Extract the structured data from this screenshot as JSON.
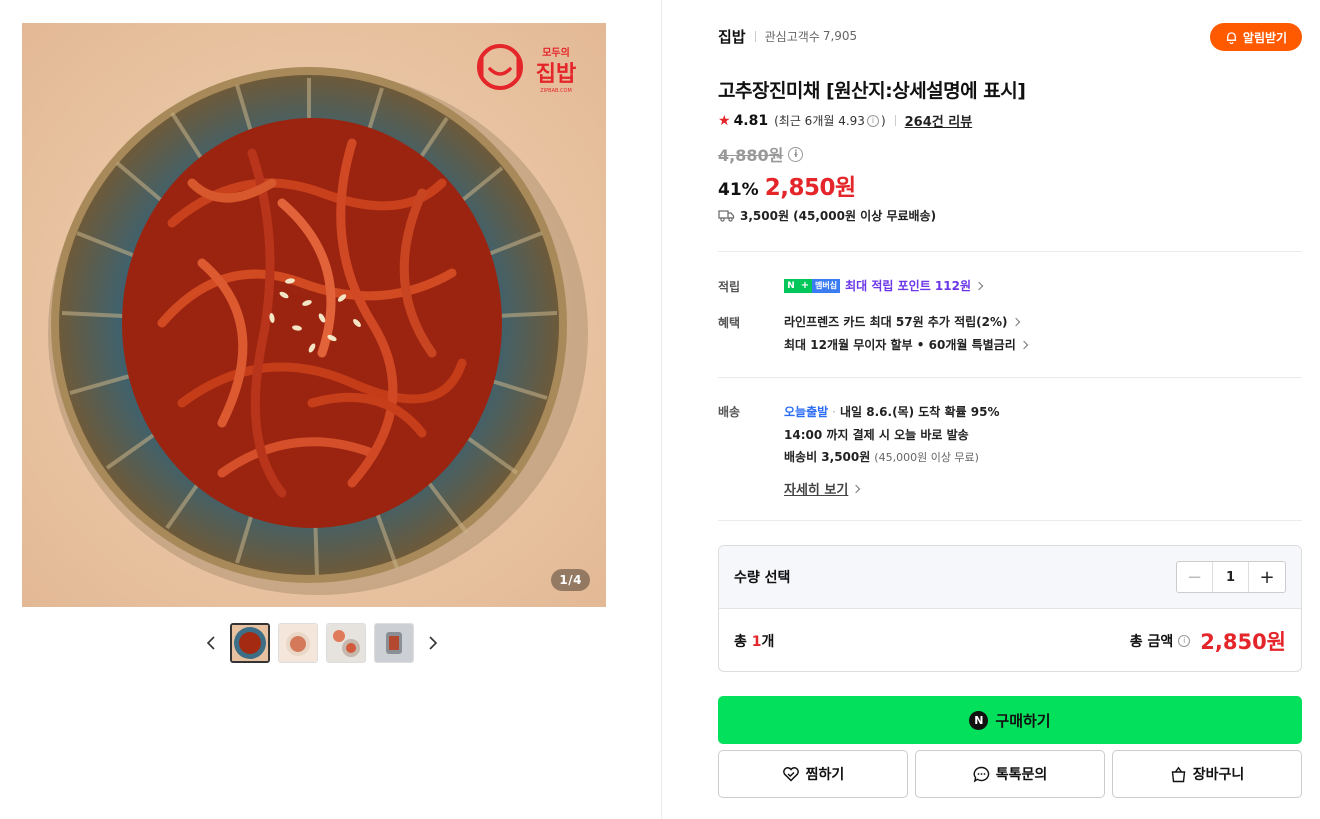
{
  "gallery": {
    "counter": "1/4",
    "brand_top": "모두의",
    "brand_main": "집밥",
    "brand_sub": "ZIPBAB.COM",
    "thumb_count": 4
  },
  "store": {
    "name": "집밥",
    "fan_label": "관심고객수",
    "fan_count": "7,905",
    "alarm_label": "알림받기"
  },
  "product": {
    "title": "고추장진미채 [원산지:상세설명에 표시]",
    "rating": "4.81",
    "recent_rating": "(최근 6개월 4.93",
    "recent_close": ")",
    "review_count": "264건 리뷰",
    "original_price": "4,880원",
    "discount": "41%",
    "price": "2,850원",
    "shipping": "3,500원 (45,000원 이상 무료배송)"
  },
  "benefits": {
    "points_label": "적립",
    "points_badge_n": "N",
    "points_badge_plus": "+",
    "points_badge_member": "멤버십",
    "points_text": "최대 적립 포인트 112원",
    "perks_label": "혜택",
    "perk1": "라인프렌즈 카드 최대 57원 추가 적립(2%)",
    "perk2": "최대 12개월 무이자 할부 • 60개월 특별금리"
  },
  "delivery": {
    "label": "배송",
    "today": "오늘출발",
    "arrival": "내일 8.6.(목) 도착 확률 95%",
    "cutoff": "14:00 까지 결제 시 오늘 바로 발송",
    "fee": "배송비 3,500원",
    "fee_note": "(45,000원 이상 무료)",
    "detail_link": "자세히 보기"
  },
  "quantity": {
    "label": "수량 선택",
    "value": "1",
    "total_prefix": "총 ",
    "total_count": "1",
    "total_suffix": "개",
    "total_label": "총 금액",
    "total_price": "2,850원"
  },
  "actions": {
    "buy": "구매하기",
    "buy_badge": "N",
    "wish": "찜하기",
    "talk": "톡톡문의",
    "cart": "장바구니"
  },
  "colors": {
    "accent_red": "#e4252a",
    "alarm_orange": "#ff5a00",
    "buy_green": "#03e05c",
    "points_purple": "#6b36e8",
    "today_blue": "#2d6df5"
  }
}
